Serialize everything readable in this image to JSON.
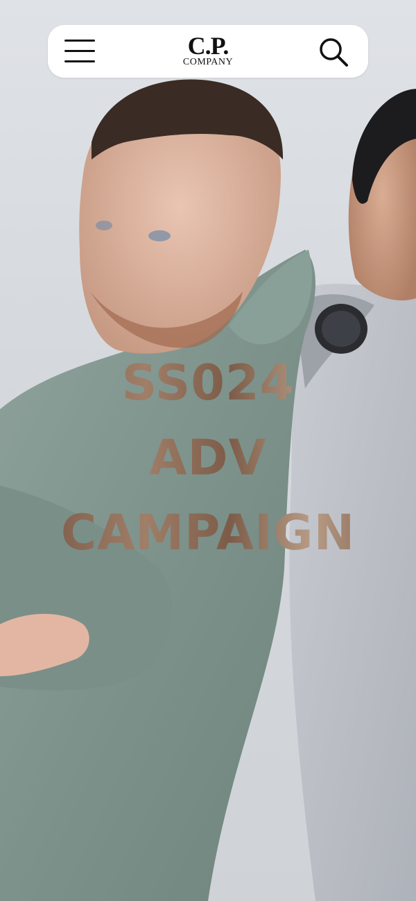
{
  "header": {
    "menu_icon": "hamburger-menu-icon",
    "logo_mark": "C.P.",
    "logo_word": "COMPANY",
    "search_icon": "search-icon"
  },
  "hero": {
    "image_subject": "two models in jackets, back to back",
    "headline_lines": [
      "SS024",
      "ADV",
      "CAMPAIGN"
    ],
    "text_color": "#8a6650"
  },
  "colors": {
    "background": "#d7dadd",
    "header_bg": "#ffffff",
    "icon": "#111111"
  }
}
